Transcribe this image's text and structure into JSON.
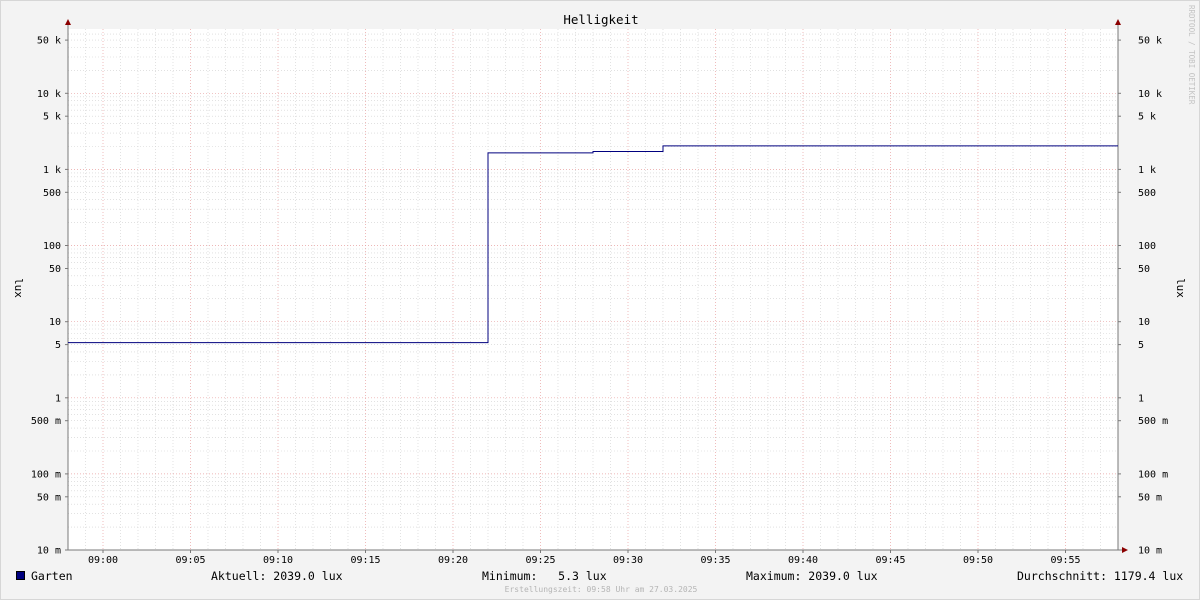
{
  "chart_data": {
    "type": "line",
    "title": "Helligkeit",
    "ylabel": "lux",
    "ylabel_right": "lux",
    "y_scale": "log",
    "ylim": [
      0.01,
      70000
    ],
    "y_tick_values": [
      0.01,
      0.05,
      0.1,
      0.5,
      1,
      5,
      10,
      50,
      100,
      500,
      1000,
      5000,
      10000,
      50000
    ],
    "y_tick_labels": [
      "10 m",
      "50 m",
      "100 m",
      "500 m",
      "1",
      "5",
      "10",
      "50",
      "100",
      "500",
      "1 k",
      "5 k",
      "10 k",
      "50 k"
    ],
    "xlim": [
      "08:58",
      "09:58"
    ],
    "x_tick_labels": [
      "09:00",
      "09:05",
      "09:10",
      "09:15",
      "09:20",
      "09:25",
      "09:30",
      "09:35",
      "09:40",
      "09:45",
      "09:50",
      "09:55"
    ],
    "grid": true,
    "legend_position": "bottom",
    "series": [
      {
        "name": "Garten",
        "color": "#00007f",
        "step": true,
        "x": [
          "08:58",
          "09:22",
          "09:28",
          "09:32",
          "09:58"
        ],
        "values": [
          5.3,
          1650,
          1720,
          2039,
          2039
        ]
      }
    ]
  },
  "legend": {
    "series_name": "Garten",
    "current": "Aktuell: 2039.0 lux",
    "minimum": "Minimum:   5.3 lux",
    "maximum": "Maximum: 2039.0 lux",
    "average": "Durchschnitt: 1179.4 lux"
  },
  "footer": "Erstellungszeit: 09:58 Uhr am 27.03.2025",
  "watermark": "RRDTOOL / TOBI OETIKER",
  "colors": {
    "background": "#f3f3f3",
    "plot_background": "#ffffff",
    "series": "#00007f",
    "major_grid": "#e8a0a0",
    "minor_grid": "#d0d0d0",
    "axis": "#7a7a7a",
    "arrow": "#8b0000"
  }
}
